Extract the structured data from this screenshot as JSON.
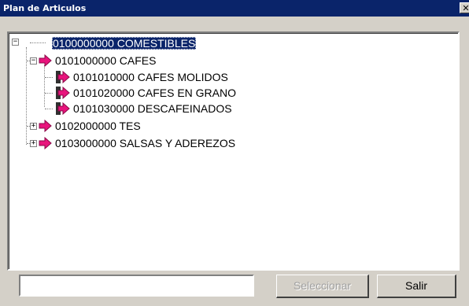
{
  "window": {
    "title": "Plan de Articulos",
    "close_glyph": "✕"
  },
  "tree": {
    "nodes": [
      {
        "label": "0100000000 COMESTIBLES",
        "expander": "−",
        "selected": true
      },
      {
        "label": "0101000000 CAFES",
        "expander": "−",
        "icon": "pink-arrow-icon"
      },
      {
        "label": "0101010000 CAFES MOLIDOS",
        "icon": "pink-arrow-icon"
      },
      {
        "label": "0101020000 CAFES EN GRANO",
        "icon": "pink-arrow-icon"
      },
      {
        "label": "0101030000 DESCAFEINADOS",
        "icon": "pink-arrow-icon"
      },
      {
        "label": "0102000000 TES",
        "expander": "+",
        "icon": "pink-arrow-icon"
      },
      {
        "label": "0103000000 SALSAS Y ADEREZOS",
        "expander": "+",
        "icon": "pink-arrow-icon"
      }
    ]
  },
  "footer": {
    "code_value": "",
    "select_label": "Seleccionar",
    "select_enabled": false,
    "exit_label": "Salir"
  },
  "colors": {
    "title_bg": "#0a246a",
    "selection_bg": "#0a246a",
    "arrow": "#e8147c",
    "window_bg": "#d4d0c8"
  }
}
